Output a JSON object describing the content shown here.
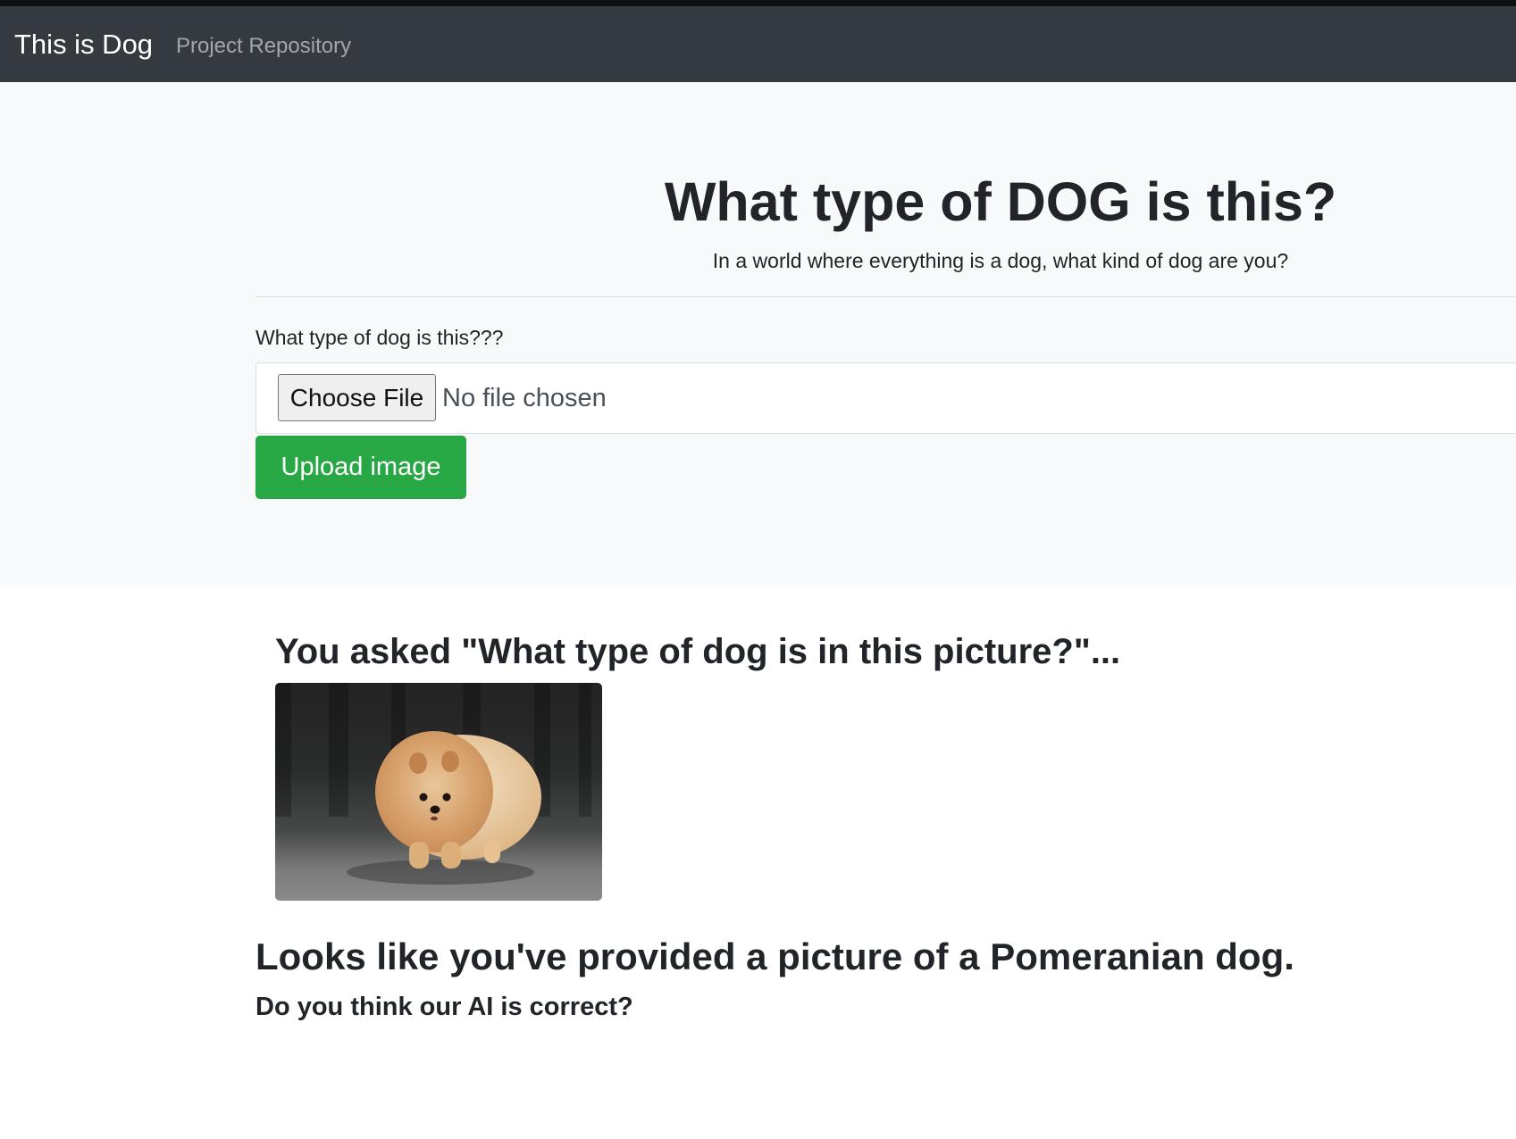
{
  "navbar": {
    "brand": "This is Dog",
    "links": [
      {
        "label": "Project Repository"
      }
    ]
  },
  "hero": {
    "title": "What type of DOG is this?",
    "lead": "In a world where everything is a dog, what kind of dog are you?"
  },
  "form": {
    "label": "What type of dog is this???",
    "file_button": "Choose File",
    "file_status": "No file chosen",
    "submit_label": "Upload image"
  },
  "result": {
    "asked": "You asked \"What type of dog is in this picture?\"...",
    "answer": "Looks like you've provided a picture of a Pomeranian dog.",
    "question": "Do you think our AI is correct?"
  },
  "colors": {
    "navbar": "#343a40",
    "jumbotron": "#f8f9fa",
    "success": "#28a745"
  }
}
